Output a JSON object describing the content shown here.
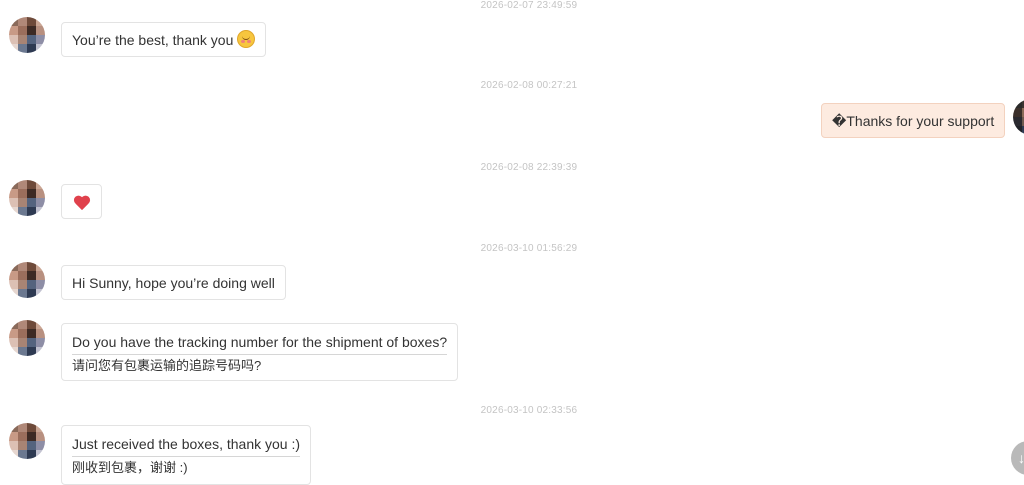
{
  "chat": {
    "timestamps": [
      "2026-02-07 23:49:59",
      "2026-02-08 00:27:21",
      "2026-02-08 22:39:39",
      "2026-03-10 01:56:29",
      "2026-03-10 02:33:56"
    ],
    "messages": [
      {
        "text": "You’re the best, thank you",
        "emoji": "smiling-face-with-blush-emoji"
      },
      {
        "text": "�Thanks for your support"
      },
      {
        "emoji": "heart-emoji"
      },
      {
        "text": "Hi Sunny, hope you’re doing well"
      },
      {
        "text": "Do you have the tracking number for the shipment of boxes?",
        "translation": "请问您有包裹运输的追踪号码吗?"
      },
      {
        "text": "Just received the boxes, thank you :)",
        "translation": "刚收到包裹，谢谢 :)"
      }
    ],
    "scroll_button_icon": "arrow-down-icon",
    "outgoing_bubble_color": "#fdebe0",
    "timestamp_color": "#c4c4c4"
  }
}
